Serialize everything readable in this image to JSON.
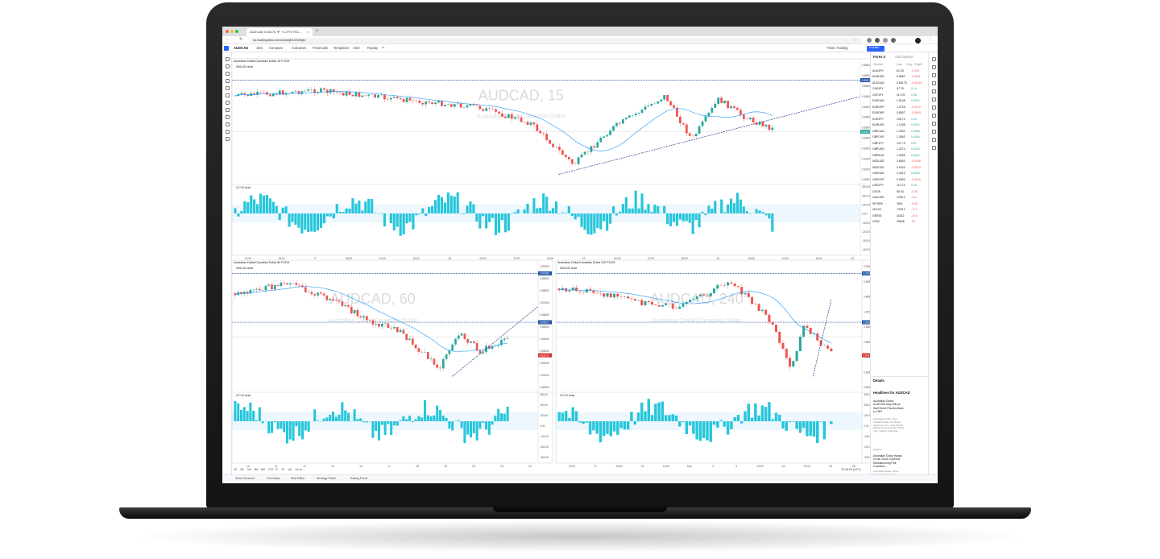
{
  "browser": {
    "tab_title": "AUDCAD 0.83175 ▼ −0.27% TSC...",
    "new_tab": "+",
    "url": "uk.tradingview.com/chart/jBVZhWqh/"
  },
  "toolbar": {
    "symbol": "AUDCAD",
    "interval": "15m",
    "compare": "Compare",
    "indicators": "Indicators",
    "financials": "Financials",
    "templates": "Templates",
    "alert": "Alert",
    "replay": "Replay",
    "broker": "TSDC Trading",
    "publish": "Publish"
  },
  "panels": [
    {
      "title": "Australian Dollar/Canadian Dollar  15  FXCM",
      "ma_legend": "SMA 100 close",
      "watermark": "AUDCAD, 15",
      "watermark_sub": "Australian Dollar/Canadian Dollar",
      "osc_legend": "CCI 20 close",
      "y_labels": [
        "0.86000",
        "0.85500",
        "0.85000",
        "0.84500",
        "0.84000",
        "0.83500",
        "0.83000",
        "0.82500",
        "0.82000",
        "0.81500",
        "0.81000",
        "0.80500"
      ],
      "osc_labels": [
        "300.00",
        "200.00",
        "100.00",
        "0.00",
        "-100.00",
        "-200.00",
        "-300.00",
        "-400.00"
      ],
      "x_labels": [
        "12:00",
        "18:00",
        "17",
        "06:00",
        "12:00",
        "18:00",
        "18",
        "06:00",
        "12:00",
        "18:00",
        "19",
        "06:00",
        "12:00",
        "18:00",
        "20",
        "06:00",
        "12:00",
        "18:00",
        "23"
      ],
      "tags": [
        {
          "value": "0.85576",
          "color": "#1e53a5"
        },
        {
          "value": "0.83175",
          "color": "#26a69a"
        }
      ]
    },
    {
      "title": "Australian Dollar/Canadian Dollar  60  FXCM",
      "ma_legend": "SMA 100 close",
      "watermark": "AUDCAD, 60",
      "watermark_sub": "Australian Dollar/Canadian Dollar",
      "osc_legend": "CCI 20 close",
      "y_labels": [
        "0.90000",
        "0.89000",
        "0.88000",
        "0.87000",
        "0.86000",
        "0.85000",
        "0.84000",
        "0.83000",
        "0.82000",
        "0.81000",
        "0.80000"
      ],
      "osc_labels": [
        "300.00",
        "200.00",
        "100.00",
        "0.00",
        "-100.00",
        "-200.00",
        "-300.00"
      ],
      "x_labels": [
        "10",
        "11",
        "12",
        "13",
        "16",
        "17",
        "18",
        "19",
        "20",
        "23",
        "24"
      ],
      "tags": [
        {
          "value": "0.90965",
          "color": "#1e53a5"
        },
        {
          "value": "0.85576",
          "color": "#1e53a5"
        },
        {
          "value": "0.83175",
          "color": "#d32f2f"
        }
      ]
    },
    {
      "title": "Australian Dollar/Canadian Dollar  240  FXCM",
      "ma_legend": "SMA 100 close",
      "watermark": "AUDCAD, 240",
      "watermark_sub": "Australian Dollar/Canadian Dollar",
      "osc_legend": "CCI 20 close",
      "y_labels": [
        "0.90000",
        "0.89000",
        "0.88000",
        "0.87000",
        "0.86000",
        "0.85000",
        "0.84000",
        "0.83000",
        "0.82000"
      ],
      "osc_labels": [
        "300.00",
        "200.00",
        "100.00",
        "0.00",
        "-100.00",
        "-200.00",
        "-300.00"
      ],
      "x_labels": [
        "14:00",
        "17",
        "14:00",
        "23",
        "14:00",
        "Mar",
        "4",
        "9",
        "13:00",
        "16",
        "13:00",
        "23",
        "26"
      ],
      "tags": [
        {
          "value": "0.90965",
          "color": "#1e53a5"
        },
        {
          "value": "0.85576",
          "color": "#1e53a5"
        },
        {
          "value": "0.83175",
          "color": "#d32f2f"
        }
      ]
    }
  ],
  "bottom": {
    "ranges": [
      "1D",
      "5D",
      "1M",
      "3M",
      "6M",
      "YTD",
      "1Y",
      "5Y",
      "All",
      "Go to..."
    ],
    "time": "19:26:28 (UTC)",
    "tabs": [
      "Stock Screener",
      "Text Notes",
      "Pine Editor",
      "Strategy Tester",
      "Trading Panel"
    ]
  },
  "watchlist": {
    "header": "Forex 0",
    "add_btn": "Add symbol",
    "cols": [
      "Symbol",
      "Last",
      "Chg",
      "Chg%"
    ],
    "rows": [
      {
        "sym": "AUDJPY",
        "last": "81.33",
        "chg": "-0.215",
        "dir": "dn"
      },
      {
        "sym": "AUDUSD",
        "last": "0.6667",
        "chg": "-0.0011",
        "dir": "dn"
      },
      {
        "sym": "AUDCAD",
        "last": "0.83175",
        "chg": "-0.00224",
        "dir": "dn"
      },
      {
        "sym": "CADJPY",
        "last": "97.79",
        "chg": "0.14",
        "dir": "up"
      },
      {
        "sym": "CHFJPY",
        "last": "117.09",
        "chg": "0.08",
        "dir": "up"
      },
      {
        "sym": "EURCAD",
        "last": "1.5148",
        "chg": "0.0021",
        "dir": "up"
      },
      {
        "sym": "EURCHF",
        "last": "1.0726",
        "chg": "-0.0013",
        "dir": "dn"
      },
      {
        "sym": "EURGBP",
        "last": "0.8507",
        "chg": "-0.0009",
        "dir": "dn"
      },
      {
        "sym": "EURJPY",
        "last": "125.72",
        "chg": "0.40",
        "dir": "up"
      },
      {
        "sym": "EURUSD",
        "last": "1.1295",
        "chg": "0.0012",
        "dir": "up"
      },
      {
        "sym": "GBPCAD",
        "last": "1.7801",
        "chg": "0.0066",
        "dir": "up"
      },
      {
        "sym": "GBPCHF",
        "last": "1.2602",
        "chg": "0.0004",
        "dir": "up"
      },
      {
        "sym": "GBPJPY",
        "last": "147.73",
        "chg": "0.67",
        "dir": "up"
      },
      {
        "sym": "GBPUSD",
        "last": "1.3274",
        "chg": "0.0023",
        "dir": "up"
      },
      {
        "sym": "GBPAUD",
        "last": "1.9905",
        "chg": "0.0119",
        "dir": "up"
      },
      {
        "sym": "NZDUSD",
        "last": "0.6833",
        "chg": "-0.0008",
        "dir": "dn"
      },
      {
        "sym": "NZDCAD",
        "last": "0.9118",
        "chg": "-0.0013",
        "dir": "dn"
      },
      {
        "sym": "USDCAD",
        "last": "1.3412",
        "chg": "0.0016",
        "dir": "up"
      },
      {
        "sym": "USDCHF",
        "last": "0.9500",
        "chg": "-0.0016",
        "dir": "dn"
      },
      {
        "sym": "USDJPY",
        "last": "110.73",
        "chg": "0.16",
        "dir": "up"
      },
      {
        "sym": "USOIL",
        "last": "55.43",
        "chg": "-0.16",
        "dir": "dn"
      },
      {
        "sym": "XAUUSD",
        "last": "1298.4",
        "chg": "-0.6",
        "dir": "dn"
      },
      {
        "sym": "SPX500",
        "last": "2801",
        "chg": "-0.45",
        "dir": "dn"
      },
      {
        "sym": "UK100",
        "last": "7226.1",
        "chg": "-17.1",
        "dir": "dn"
      },
      {
        "sym": "GER30",
        "last": "11612",
        "chg": "-29.5",
        "dir": "dn"
      },
      {
        "sym": "US30",
        "last": "25848",
        "chg": "-93",
        "dir": "dn"
      }
    ]
  },
  "details": {
    "title": "Details",
    "headlines_title": "Headlines for AUDCAD",
    "news": [
      {
        "headline": "Australian Dollar, AUD/USD May Wilt as Wall Street Flashes Back to 1987",
        "body": "Australian Dollar, New Zealand Dollar, US Dollar, Japanese Yen - Asia Pacific Market Openamerican Dollar may cushion downside...",
        "source": "DailyFX"
      },
      {
        "headline": "Australian Dollar Hangs on as China Cushions Manufacturing PMI Crumbles",
        "body": "Australian Dollar, China Caixin Manufacturing Purchasing Managers Index, Trading Points The Australian Dollar fell on further despite...",
        "source": "DailyFX"
      }
    ]
  },
  "colors": {
    "up": "#26a69a",
    "down": "#ef5350",
    "ma": "#2196f3",
    "cci": "#26c6da",
    "trend": "#1e3a8a",
    "level": "#1e53a5"
  }
}
